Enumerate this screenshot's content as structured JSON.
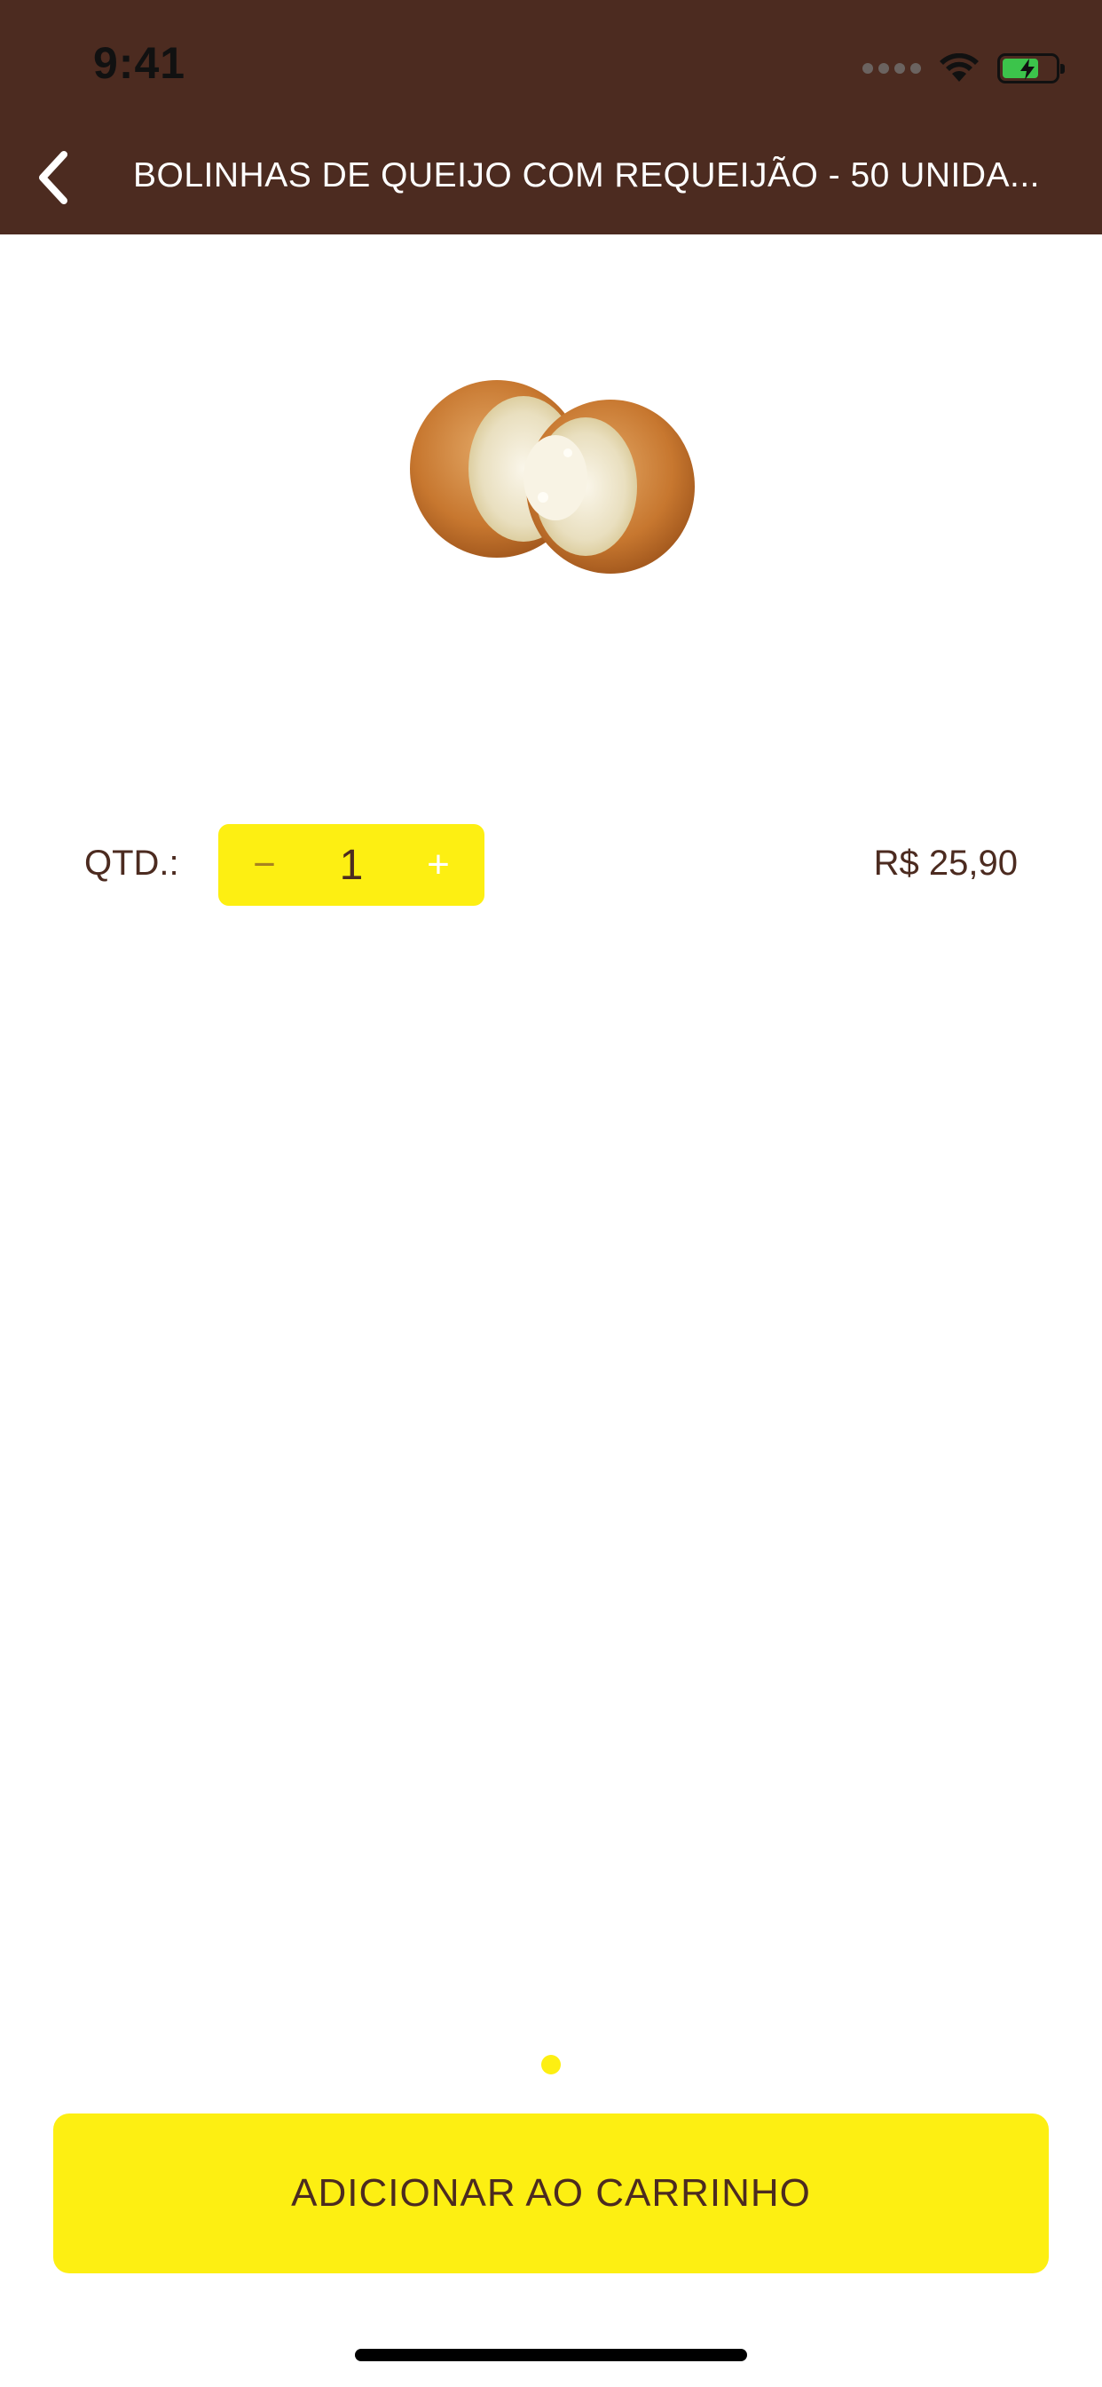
{
  "status_bar": {
    "time": "9:41",
    "signal_icon": "signal-dots-icon",
    "wifi_icon": "wifi-icon",
    "battery_icon": "battery-charging-icon"
  },
  "nav": {
    "back_icon": "chevron-left-icon",
    "title": "BOLINHAS DE QUEIJO COM REQUEIJÃO - 50 UNIDA..."
  },
  "product": {
    "image_icon": "cheese-ball-image"
  },
  "quantity": {
    "label": "QTD.:",
    "minus_label": "−",
    "value": "1",
    "plus_label": "+"
  },
  "price": "R$ 25,90",
  "pager": {
    "pages": 1,
    "current": 1
  },
  "cart_button": {
    "label": "ADICIONAR AO CARRINHO"
  },
  "colors": {
    "brand_brown": "#4c2b20",
    "accent_yellow": "#fdef12"
  }
}
